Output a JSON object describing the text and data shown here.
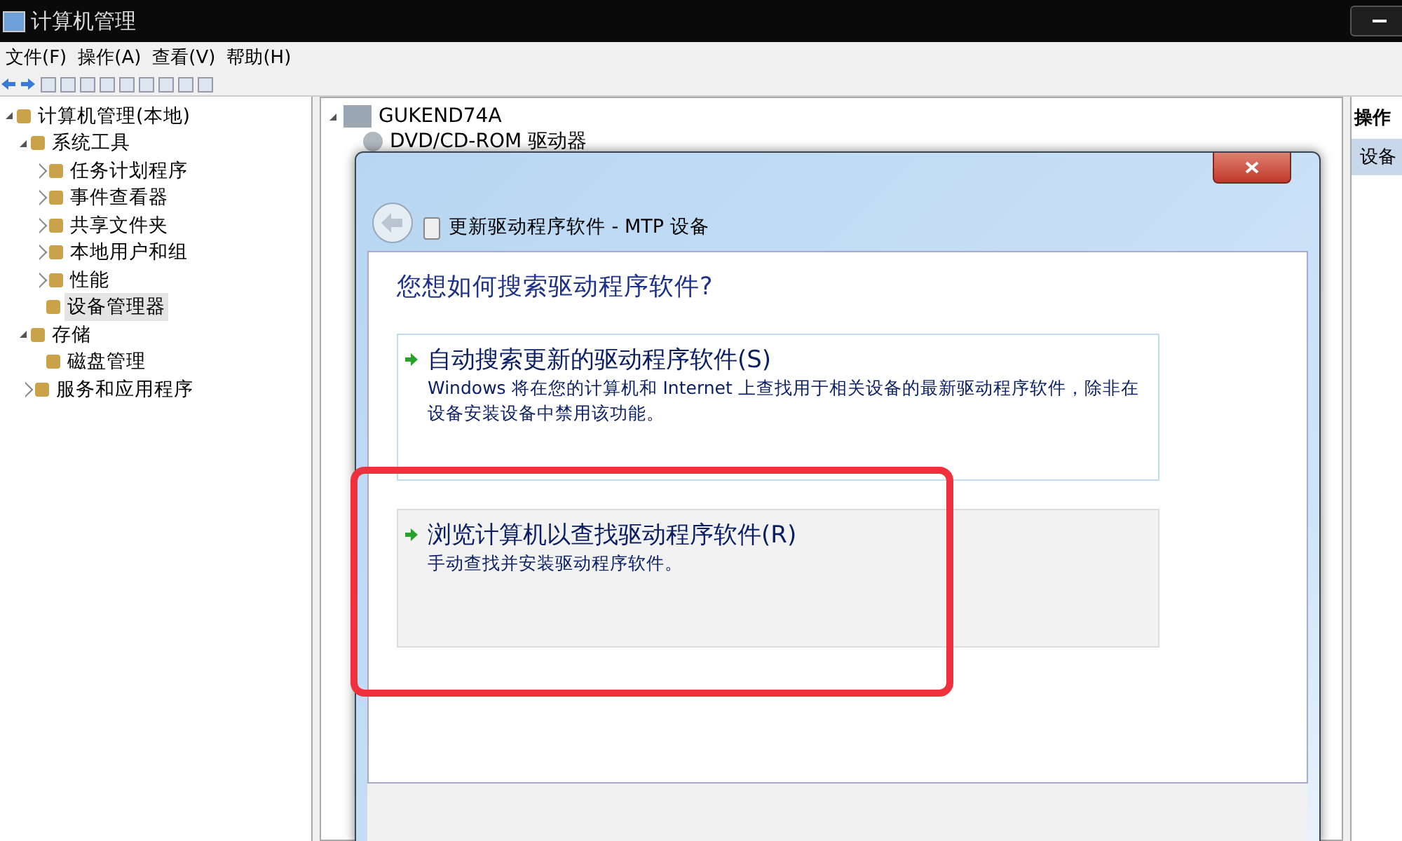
{
  "window": {
    "title": "计算机管理"
  },
  "menu": [
    "文件(F)",
    "操作(A)",
    "查看(V)",
    "帮助(H)"
  ],
  "tree": [
    {
      "label": "计算机管理(本地)",
      "expanded": true,
      "selected": false,
      "children": [
        {
          "label": "系统工具",
          "expanded": true,
          "selected": false,
          "children": [
            {
              "label": "任务计划程序",
              "expanded": false,
              "selected": false
            },
            {
              "label": "事件查看器",
              "expanded": false,
              "selected": false
            },
            {
              "label": "共享文件夹",
              "expanded": false,
              "selected": false
            },
            {
              "label": "本地用户和组",
              "expanded": false,
              "selected": false
            },
            {
              "label": "性能",
              "expanded": false,
              "selected": false
            },
            {
              "label": "设备管理器",
              "selected": true
            }
          ]
        },
        {
          "label": "存储",
          "expanded": true,
          "selected": false,
          "children": [
            {
              "label": "磁盘管理",
              "selected": false
            }
          ]
        },
        {
          "label": "服务和应用程序",
          "expanded": false,
          "selected": false
        }
      ]
    }
  ],
  "devices": {
    "computer": "GUKEND74A",
    "items": [
      "DVD/CD-ROM 驱动器"
    ]
  },
  "actions": {
    "header": "操作",
    "item": "设备"
  },
  "dialog": {
    "title": "更新驱动程序软件 - MTP 设备",
    "question": "您想如何搜索驱动程序软件?",
    "options": [
      {
        "title": "自动搜索更新的驱动程序软件(S)",
        "description": "Windows 将在您的计算机和 Internet 上查找用于相关设备的最新驱动程序软件，除非在设备安装设备中禁用该功能。",
        "selected": false
      },
      {
        "title": "浏览计算机以查找驱动程序软件(R)",
        "description": "手动查找并安装驱动程序软件。",
        "selected": true
      }
    ]
  }
}
